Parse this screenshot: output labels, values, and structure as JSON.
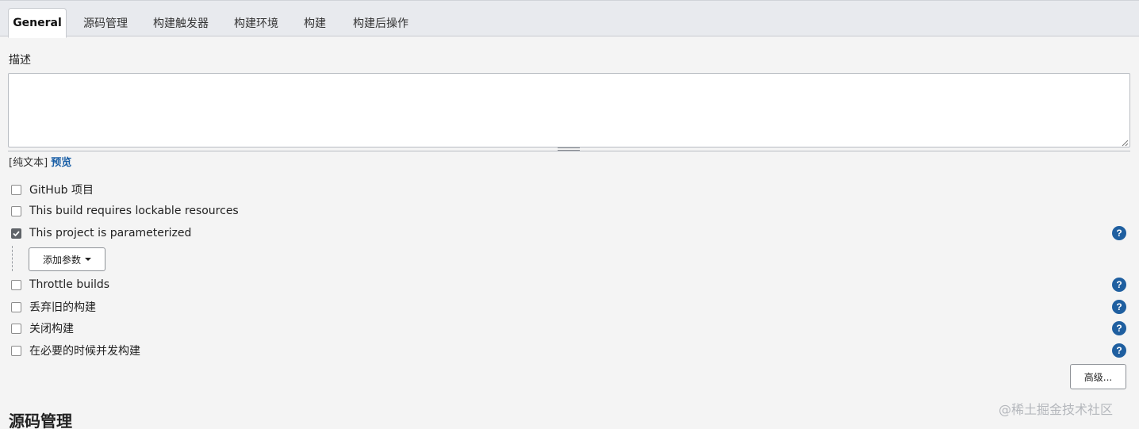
{
  "tabs": [
    {
      "label": "General",
      "active": true
    },
    {
      "label": "源码管理"
    },
    {
      "label": "构建触发器"
    },
    {
      "label": "构建环境"
    },
    {
      "label": "构建"
    },
    {
      "label": "构建后操作"
    }
  ],
  "description": {
    "label": "描述",
    "value": "",
    "format_text": "[纯文本]",
    "preview_link": "预览"
  },
  "options": [
    {
      "label": "GitHub 项目",
      "checked": false
    },
    {
      "label": "This build requires lockable resources",
      "checked": false
    },
    {
      "label": "This project is parameterized",
      "checked": true
    },
    {
      "label": "Throttle builds",
      "checked": false
    },
    {
      "label": "丢弃旧的构建",
      "checked": false
    },
    {
      "label": "关闭构建",
      "checked": false
    },
    {
      "label": "在必要的时候并发构建",
      "checked": false
    }
  ],
  "help_symbol": "?",
  "add_param_button": "添加参数",
  "advanced_button": "高级...",
  "next_section_title": "源码管理",
  "watermark": "@稀土掘金技术社区",
  "colors": {
    "accent": "#1a5fa6",
    "help_icon": "#1f5fa0"
  }
}
